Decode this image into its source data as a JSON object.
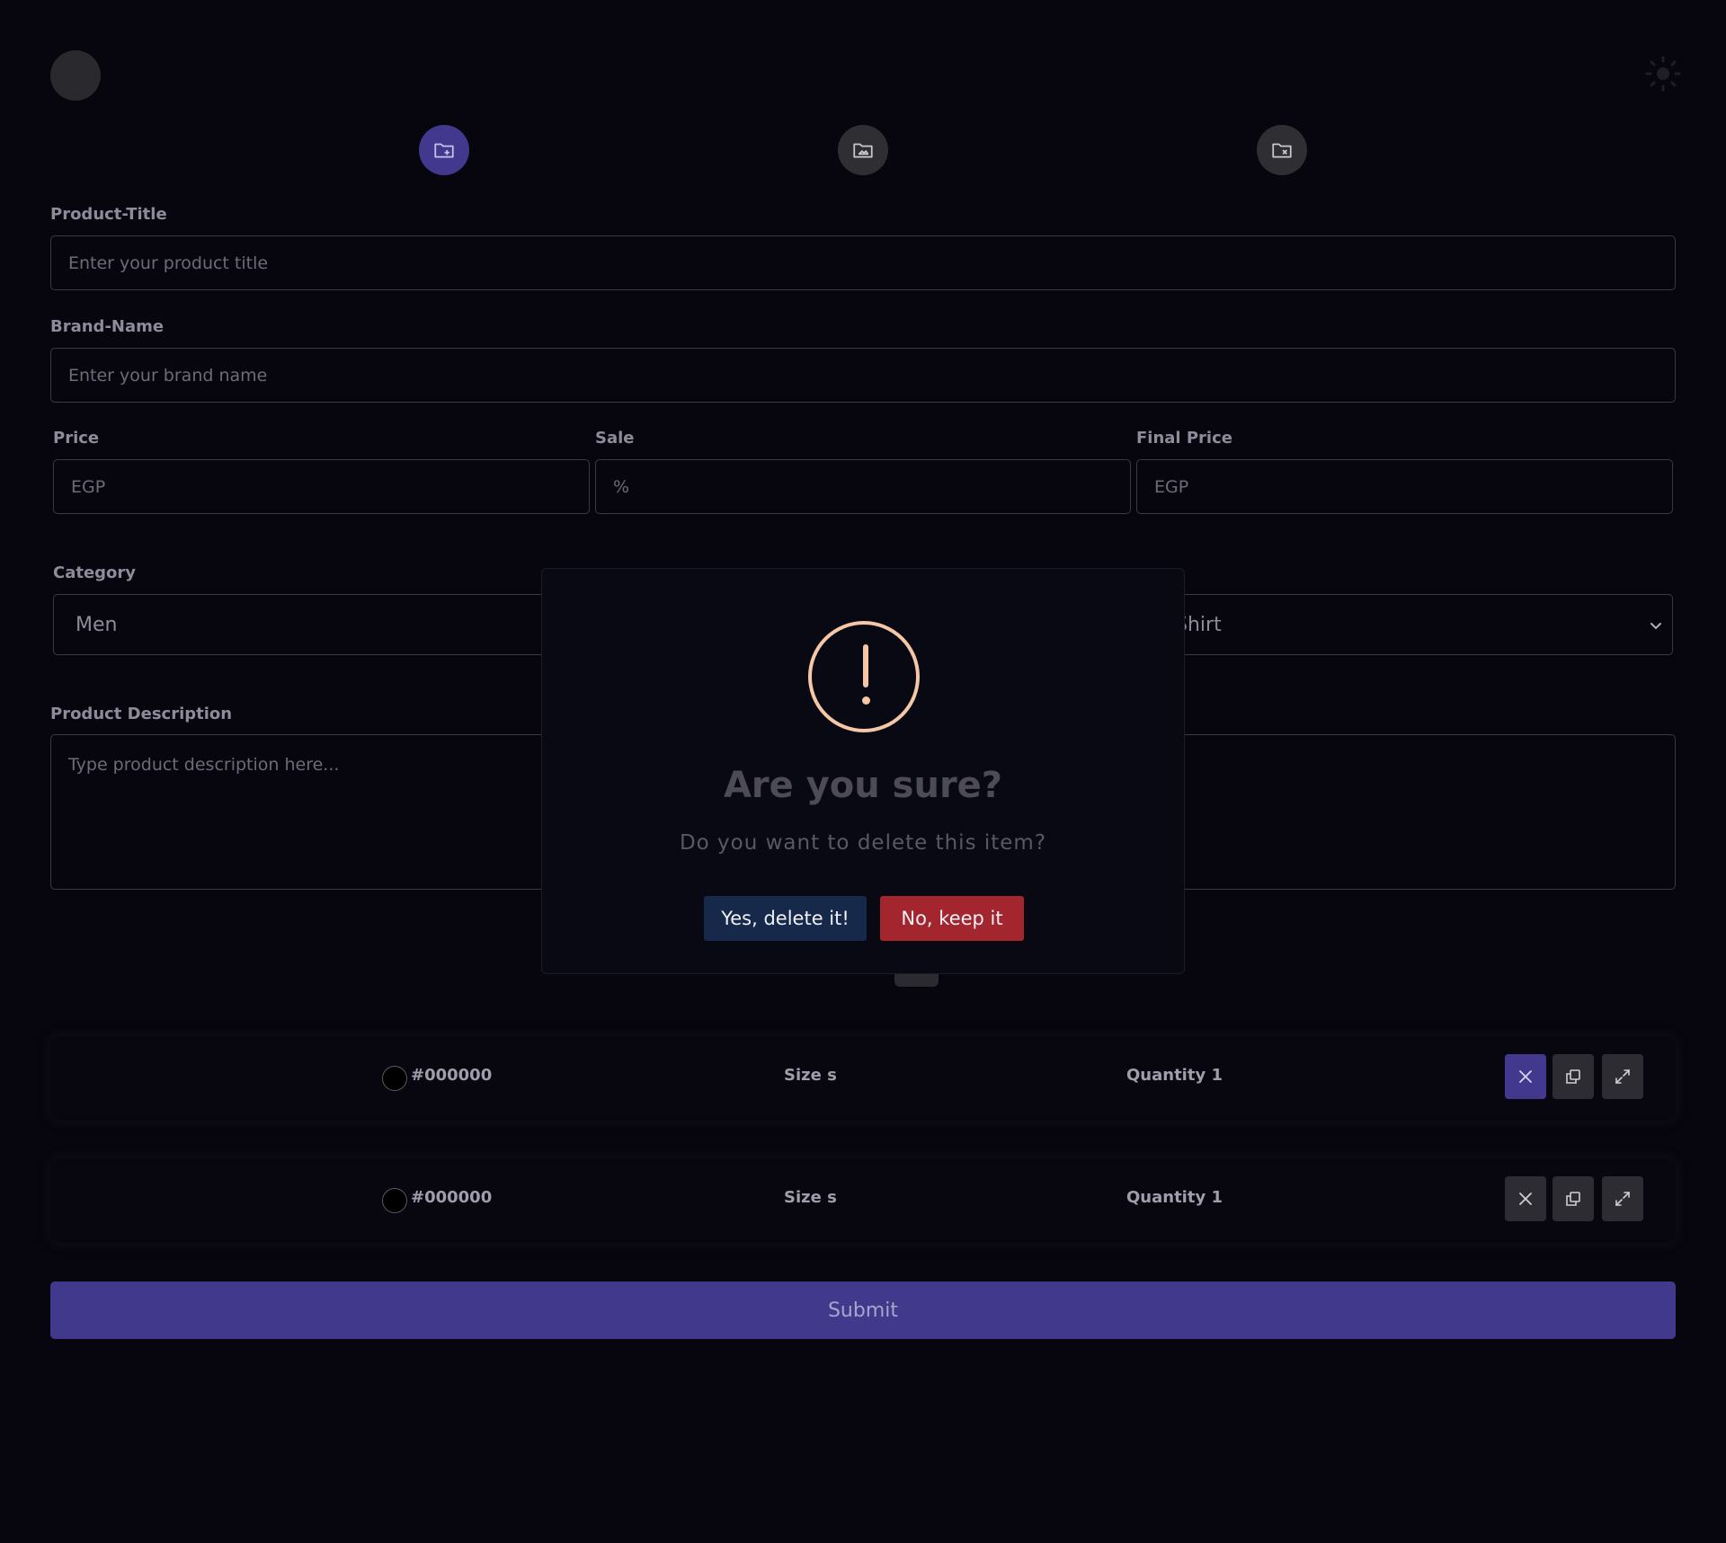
{
  "steps": [
    {
      "icon": "folder-plus-icon",
      "active": true
    },
    {
      "icon": "folder-image-icon",
      "active": false
    },
    {
      "icon": "folder-x-icon",
      "active": false
    }
  ],
  "form": {
    "title_label": "Product-Title",
    "title_placeholder": "Enter your product title",
    "brand_label": "Brand-Name",
    "brand_placeholder": "Enter your brand name",
    "price_label": "Price",
    "price_placeholder": "EGP",
    "sale_label": "Sale",
    "sale_placeholder": "%",
    "final_label": "Final Price",
    "final_placeholder": "EGP",
    "category_label": "Category",
    "category_value": "Men",
    "third_select_value": "Shirt",
    "description_label": "Product Description",
    "description_placeholder": "Type product description here..."
  },
  "variants": [
    {
      "color": "#000000",
      "size": "Size s",
      "quantity": "Quantity 1"
    },
    {
      "color": "#000000",
      "size": "Size s",
      "quantity": "Quantity 1"
    }
  ],
  "submit_label": "Submit",
  "modal": {
    "title": "Are you sure?",
    "text": "Do you want to delete this item?",
    "confirm_label": "Yes, delete it!",
    "cancel_label": "No, keep it"
  },
  "colors": {
    "accent": "#42398e",
    "warning": "#f5c7a6",
    "danger": "#a3262f",
    "confirm": "#16294b"
  }
}
